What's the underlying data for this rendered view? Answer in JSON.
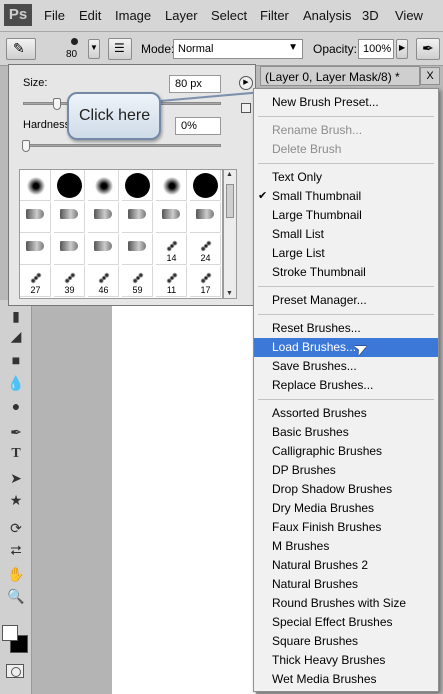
{
  "app": {
    "logo": "Ps"
  },
  "menubar": {
    "items": [
      "File",
      "Edit",
      "Image",
      "Layer",
      "Select",
      "Filter",
      "Analysis",
      "3D",
      "View"
    ]
  },
  "options": {
    "brush_size": "80",
    "mode_label": "Mode:",
    "mode_value": "Normal",
    "opacity_label": "Opacity:",
    "opacity_value": "100%"
  },
  "document": {
    "tab_title": "(Layer 0, Layer Mask/8) *",
    "close": "X"
  },
  "brush_panel": {
    "size_label": "Size:",
    "size_value": "80 px",
    "hardness_label": "Hardness:",
    "hardness_value": "0%",
    "size_level": 0.15,
    "hardness_level": 0.0,
    "presets": [
      {
        "kind": "soft",
        "num": ""
      },
      {
        "kind": "hard",
        "num": ""
      },
      {
        "kind": "soft",
        "num": ""
      },
      {
        "kind": "hard",
        "num": ""
      },
      {
        "kind": "soft",
        "num": ""
      },
      {
        "kind": "hard",
        "num": ""
      },
      {
        "kind": "bristle",
        "num": ""
      },
      {
        "kind": "bristle",
        "num": ""
      },
      {
        "kind": "bristle",
        "num": ""
      },
      {
        "kind": "bristle",
        "num": ""
      },
      {
        "kind": "bristle",
        "num": ""
      },
      {
        "kind": "bristle",
        "num": ""
      },
      {
        "kind": "bristle",
        "num": ""
      },
      {
        "kind": "bristle",
        "num": ""
      },
      {
        "kind": "bristle",
        "num": ""
      },
      {
        "kind": "bristle",
        "num": ""
      },
      {
        "kind": "splat",
        "num": "14"
      },
      {
        "kind": "splat",
        "num": "24"
      },
      {
        "kind": "splat",
        "num": "27"
      },
      {
        "kind": "splat",
        "num": "39"
      },
      {
        "kind": "splat",
        "num": "46"
      },
      {
        "kind": "splat",
        "num": "59"
      },
      {
        "kind": "splat",
        "num": "11"
      },
      {
        "kind": "splat",
        "num": "17"
      }
    ]
  },
  "callout": {
    "text": "Click here"
  },
  "context_menu": {
    "groups": [
      [
        {
          "label": "New Brush Preset...",
          "disabled": false
        }
      ],
      [
        {
          "label": "Rename Brush...",
          "disabled": true
        },
        {
          "label": "Delete Brush",
          "disabled": true
        }
      ],
      [
        {
          "label": "Text Only"
        },
        {
          "label": "Small Thumbnail",
          "checked": true
        },
        {
          "label": "Large Thumbnail"
        },
        {
          "label": "Small List"
        },
        {
          "label": "Large List"
        },
        {
          "label": "Stroke Thumbnail"
        }
      ],
      [
        {
          "label": "Preset Manager..."
        }
      ],
      [
        {
          "label": "Reset Brushes..."
        },
        {
          "label": "Load Brushes...",
          "highlight": true
        },
        {
          "label": "Save Brushes..."
        },
        {
          "label": "Replace Brushes..."
        }
      ],
      [
        {
          "label": "Assorted Brushes"
        },
        {
          "label": "Basic Brushes"
        },
        {
          "label": "Calligraphic Brushes"
        },
        {
          "label": "DP Brushes"
        },
        {
          "label": "Drop Shadow Brushes"
        },
        {
          "label": "Dry Media Brushes"
        },
        {
          "label": "Faux Finish Brushes"
        },
        {
          "label": "M Brushes"
        },
        {
          "label": "Natural Brushes 2"
        },
        {
          "label": "Natural Brushes"
        },
        {
          "label": "Round Brushes with Size"
        },
        {
          "label": "Special Effect Brushes"
        },
        {
          "label": "Square Brushes"
        },
        {
          "label": "Thick Heavy Brushes"
        },
        {
          "label": "Wet Media Brushes"
        }
      ]
    ]
  },
  "tools": [
    "eraser-icon",
    "paint-bucket-icon",
    "gradient-icon",
    "blur-icon",
    "dodge-icon",
    "pen-icon",
    "type-icon",
    "path-selection-icon",
    "shape-icon",
    "3d-rotate-icon",
    "3d-orbit-icon",
    "hand-icon",
    "zoom-icon"
  ],
  "colors": {
    "highlight": "#3c78d8",
    "menu_bg": "#f1f1f1",
    "chrome": "#d6d6d6"
  }
}
